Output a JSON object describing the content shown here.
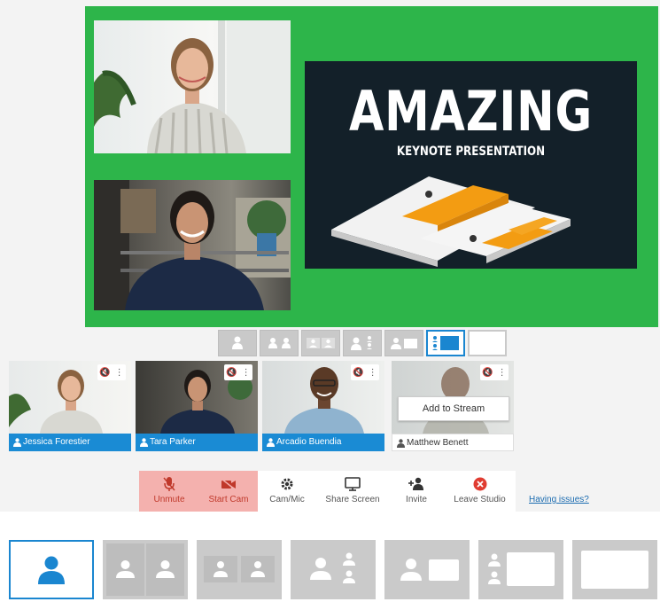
{
  "stage": {
    "slide": {
      "title": "AMAZING",
      "subtitle": "KEYNOTE PRESENTATION"
    }
  },
  "colors": {
    "stage_bg": "#2db54a",
    "accent": "#1a86d0",
    "name_bar": "#1a8bd4",
    "toolbar_red": "#f4b1ae",
    "leave_red": "#e03c31"
  },
  "participants": [
    {
      "name": "Jessica Forestier",
      "on_stream": true
    },
    {
      "name": "Tara Parker",
      "on_stream": true
    },
    {
      "name": "Arcadio Buendia",
      "on_stream": true
    },
    {
      "name": "Matthew Benett",
      "on_stream": false,
      "action": "Add to Stream"
    }
  ],
  "toolbar": {
    "unmute": "Unmute",
    "start_cam": "Start Cam",
    "cam_mic": "Cam/Mic",
    "share_screen": "Share Screen",
    "invite": "Invite",
    "leave_studio": "Leave Studio",
    "having_issues": "Having issues?"
  },
  "layouts": {
    "options": [
      "solo",
      "split-2",
      "grid-2-inset",
      "person-plus-stack",
      "person-plus-wide",
      "stack-plus-wide",
      "blank"
    ],
    "selected_small": "person-plus-wide",
    "selected_large": "solo"
  },
  "icons": [
    "person-icon",
    "mic-off-icon",
    "cam-off-icon",
    "gear-icon",
    "monitor-icon",
    "add-person-icon",
    "close-circle-icon",
    "more-icon"
  ]
}
